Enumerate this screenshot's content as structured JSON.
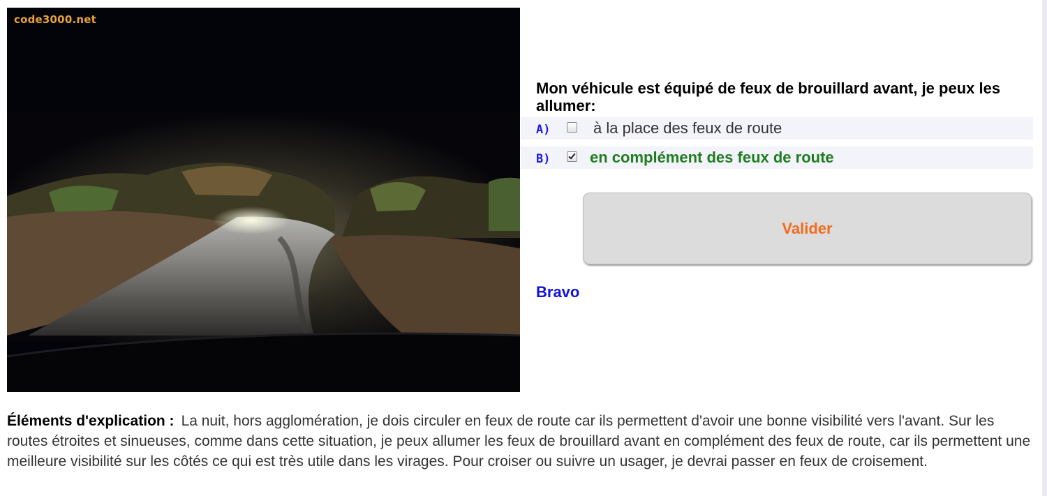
{
  "photo": {
    "watermark": "code3000.net",
    "description_icon": "night-road-photo"
  },
  "question": {
    "text": "Mon véhicule est équipé de feux de brouillard avant, je peux les allumer:"
  },
  "answers": [
    {
      "letter": "A)",
      "text": "à la place des feux de route",
      "checked": false,
      "correct": false
    },
    {
      "letter": "B)",
      "text": "en complément des feux de route",
      "checked": true,
      "correct": true
    }
  ],
  "validate_label": "Valider",
  "result": "Bravo",
  "explanation": {
    "label": "Éléments d'explication :",
    "text": "La nuit, hors agglomération, je dois circuler en feux de route car ils permettent d'avoir une bonne visibilité vers l'avant. Sur les routes étroites et sinueuses, comme dans cette situation, je peux allumer les feux de brouillard avant en complément des feux de route, car ils permettent une meilleure visibilité sur les côtés ce qui est très utile dans les virages. Pour croiser ou suivre un usager, je devrai passer en feux de croisement."
  },
  "colors": {
    "letter": "#1a1ae6",
    "correct_answer": "#1e7d1e",
    "validate_text": "#f26b1d",
    "result": "#1212e0",
    "watermark": "#e8a23a"
  }
}
